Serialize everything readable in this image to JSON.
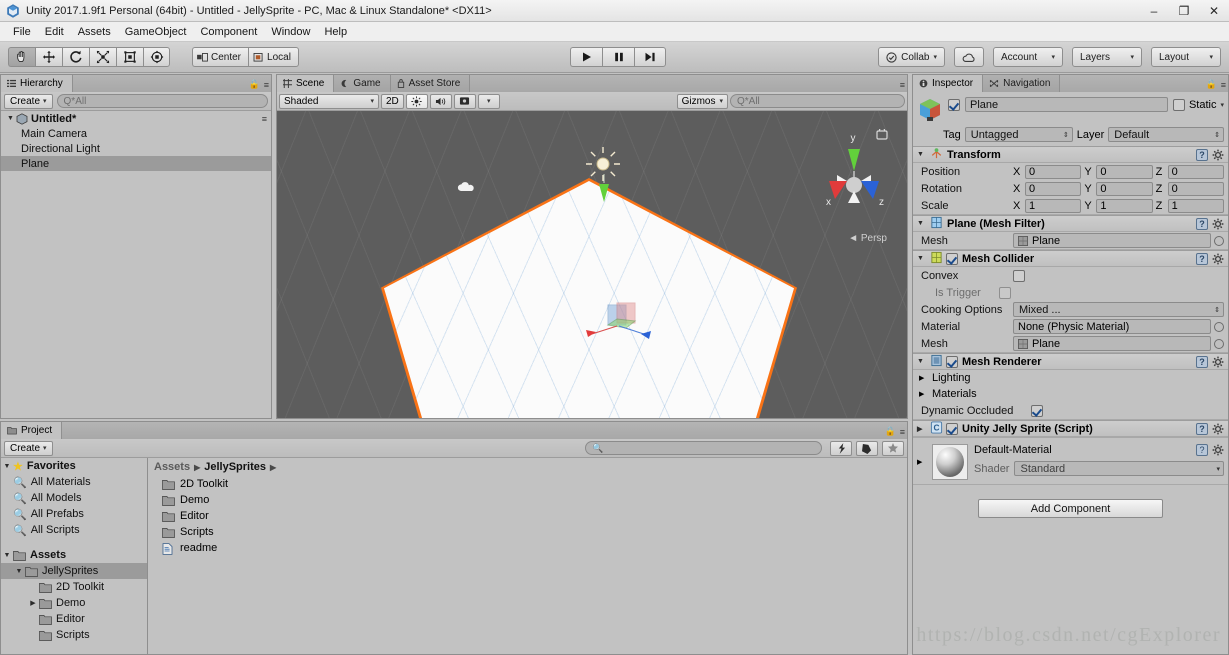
{
  "window": {
    "title": "Unity 2017.1.9f1 Personal (64bit) - Untitled - JellySprite - PC, Mac & Linux Standalone* <DX11>",
    "icon": "unity-icon",
    "minimize": "–",
    "maximize": "❐",
    "close": "✕"
  },
  "menu": {
    "items": [
      "File",
      "Edit",
      "Assets",
      "GameObject",
      "Component",
      "Window",
      "Help"
    ]
  },
  "toolbar": {
    "tools": [
      {
        "name": "hand-tool",
        "glyph": "✋"
      },
      {
        "name": "move-tool",
        "glyph": "✥"
      },
      {
        "name": "rotate-tool",
        "glyph": "↻"
      },
      {
        "name": "scale-tool",
        "glyph": "⤡"
      },
      {
        "name": "rect-tool",
        "glyph": "▣"
      },
      {
        "name": "transform-tool",
        "glyph": "✹"
      }
    ],
    "pivot_label": "Center",
    "space_label": "Local",
    "play": "▶",
    "pause": "▐▐",
    "step": "▶|",
    "collab_label": "Collab",
    "cloud_label": "☁",
    "account_label": "Account",
    "layers_label": "Layers",
    "layout_label": "Layout"
  },
  "hierarchy": {
    "tab_label": "Hierarchy",
    "create_label": "Create",
    "search_placeholder": "Q*All",
    "scene_name": "Untitled*",
    "items": [
      {
        "label": "Main Camera",
        "selected": false
      },
      {
        "label": "Directional Light",
        "selected": false
      },
      {
        "label": "Plane",
        "selected": true
      }
    ]
  },
  "scene": {
    "tabs": [
      {
        "label": "Scene",
        "icon": "scene-icon",
        "active": true
      },
      {
        "label": "Game",
        "icon": "game-icon",
        "active": false
      },
      {
        "label": "Asset Store",
        "icon": "store-icon",
        "active": false
      }
    ],
    "shading_mode": "Shaded",
    "mode_2d": "2D",
    "lighting_toggle": "☀",
    "audio_toggle": "ὐA",
    "effects_toggle": "■",
    "gizmos_label": "Gizmos",
    "search_placeholder": "Q*All",
    "gizmo_axes": {
      "x": "x",
      "y": "y",
      "z": "z"
    },
    "projection_label": "Persp",
    "selected_object": "Plane",
    "selection_outline_color": "#f97316"
  },
  "project": {
    "tab_label": "Project",
    "create_label": "Create",
    "search_placeholder": "",
    "favorites_label": "Favorites",
    "favorites": [
      "All Materials",
      "All Models",
      "All Prefabs",
      "All Scripts"
    ],
    "assets_label": "Assets",
    "tree": [
      {
        "label": "JellySprites",
        "depth": 1,
        "selected": true,
        "expandable": true,
        "expanded": true
      },
      {
        "label": "2D Toolkit",
        "depth": 2,
        "selected": false,
        "expandable": false,
        "expanded": false
      },
      {
        "label": "Demo",
        "depth": 2,
        "selected": false,
        "expandable": true,
        "expanded": false
      },
      {
        "label": "Editor",
        "depth": 2,
        "selected": false,
        "expandable": false,
        "expanded": false
      },
      {
        "label": "Scripts",
        "depth": 2,
        "selected": false,
        "expandable": false,
        "expanded": false
      }
    ],
    "breadcrumb": [
      "Assets",
      "JellySprites"
    ],
    "contents": [
      {
        "label": "2D Toolkit",
        "type": "folder"
      },
      {
        "label": "Demo",
        "type": "folder"
      },
      {
        "label": "Editor",
        "type": "folder"
      },
      {
        "label": "Scripts",
        "type": "folder"
      },
      {
        "label": "readme",
        "type": "file"
      }
    ]
  },
  "inspector": {
    "tabs": [
      {
        "label": "Inspector",
        "icon": "inspector-icon",
        "active": true
      },
      {
        "label": "Navigation",
        "icon": "navigation-icon",
        "active": false
      }
    ],
    "object_name": "Plane",
    "object_enabled": true,
    "static_label": "Static",
    "tag_label": "Tag",
    "tag_value": "Untagged",
    "layer_label": "Layer",
    "layer_value": "Default",
    "components": [
      {
        "name": "Transform",
        "icon": "transform-icon",
        "has_checkbox": false,
        "properties": [
          {
            "label": "Position",
            "type": "vector3",
            "x": "0",
            "y": "0",
            "z": "0"
          },
          {
            "label": "Rotation",
            "type": "vector3",
            "x": "0",
            "y": "0",
            "z": "0"
          },
          {
            "label": "Scale",
            "type": "vector3",
            "x": "1",
            "y": "1",
            "z": "1"
          }
        ]
      },
      {
        "name": "Plane (Mesh Filter)",
        "icon": "meshfilter-icon",
        "has_checkbox": false,
        "properties": [
          {
            "label": "Mesh",
            "type": "object",
            "value": "Plane"
          }
        ]
      },
      {
        "name": "Mesh Collider",
        "icon": "meshcollider-icon",
        "has_checkbox": true,
        "checked": true,
        "properties": [
          {
            "label": "Convex",
            "type": "checkbox",
            "checked": false,
            "dim": false
          },
          {
            "label": "Is Trigger",
            "type": "checkbox",
            "checked": false,
            "dim": true
          },
          {
            "label": "Cooking Options",
            "type": "dropdown",
            "value": "Mixed ..."
          },
          {
            "label": "Material",
            "type": "object",
            "value": "None (Physic Material)"
          },
          {
            "label": "Mesh",
            "type": "object",
            "value": "Plane"
          }
        ]
      },
      {
        "name": "Mesh Renderer",
        "icon": "meshrenderer-icon",
        "has_checkbox": true,
        "checked": true,
        "properties": [
          {
            "label": "Lighting",
            "type": "foldout"
          },
          {
            "label": "Materials",
            "type": "foldout"
          },
          {
            "label": "Dynamic Occluded",
            "type": "checkbox",
            "checked": true,
            "dim": false
          }
        ]
      },
      {
        "name": "Unity Jelly Sprite (Script)",
        "icon": "script-icon",
        "has_checkbox": true,
        "checked": true,
        "collapsed": true,
        "properties": []
      }
    ],
    "material": {
      "name": "Default-Material",
      "shader_label": "Shader",
      "shader_value": "Standard"
    },
    "add_component_label": "Add Component"
  },
  "watermark": "https://blog.csdn.net/cgExplorer"
}
